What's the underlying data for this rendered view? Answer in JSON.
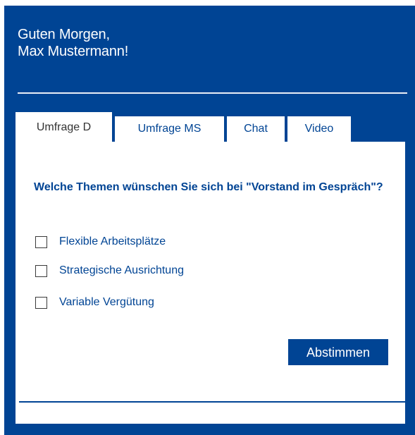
{
  "header": {
    "greeting_line1": "Guten Morgen,",
    "greeting_line2": "Max Mustermann!"
  },
  "tabs": [
    {
      "label": "Umfrage D",
      "active": true
    },
    {
      "label": "Umfrage MS",
      "active": false
    },
    {
      "label": "Chat",
      "active": false
    },
    {
      "label": "Video",
      "active": false
    }
  ],
  "survey": {
    "question": "Welche Themen wünschen Sie sich bei \"Vorstand im Gespräch\"?",
    "options": [
      {
        "label": "Flexible Arbeitsplätze",
        "checked": false
      },
      {
        "label": "Strategische Ausrichtung",
        "checked": false
      },
      {
        "label": "Variable Vergütung",
        "checked": false
      }
    ],
    "submit_label": "Abstimmen"
  },
  "colors": {
    "brand_blue": "#004494",
    "white": "#ffffff"
  }
}
